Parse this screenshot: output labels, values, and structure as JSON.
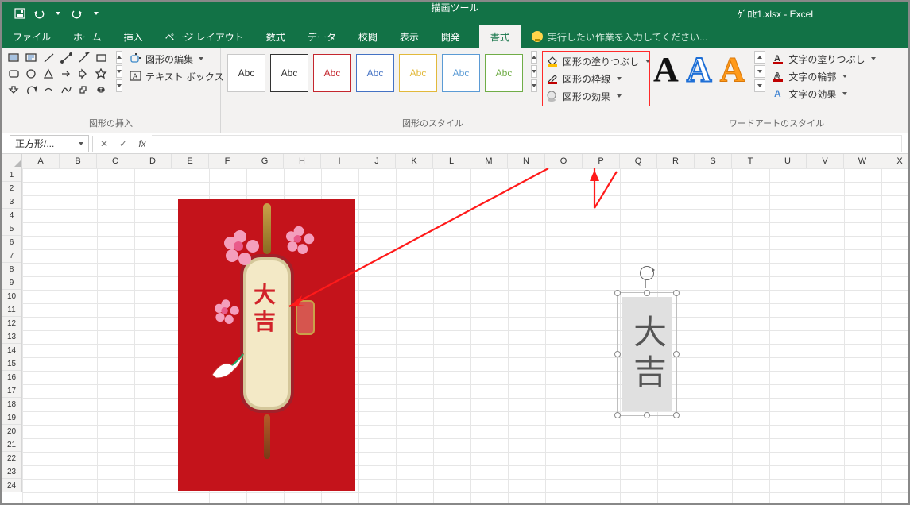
{
  "titlebar": {
    "context_label": "描画ツール",
    "doc_title": "ｹﾞﾛｾ1.xlsx - Excel"
  },
  "tabs": {
    "file": "ファイル",
    "home": "ホーム",
    "insert": "挿入",
    "layout": "ページ レイアウト",
    "formulas": "数式",
    "data": "データ",
    "review": "校閲",
    "view": "表示",
    "developer": "開発",
    "format": "書式",
    "tellme": "実行したい作業を入力してください..."
  },
  "ribbon": {
    "insert_group": "図形の挿入",
    "edit_shape": "図形の編集",
    "text_box": "テキスト ボックス",
    "style_group": "図形のスタイル",
    "style_sample": "Abc",
    "fill": "図形の塗りつぶし",
    "outline": "図形の枠線",
    "effects": "図形の効果",
    "wa_group": "ワードアートのスタイル",
    "wa_sample": "A",
    "txt_fill": "文字の塗りつぶし",
    "txt_outline": "文字の輪郭",
    "txt_effects": "文字の効果"
  },
  "fbar": {
    "name": "正方形/...",
    "expand": "▾"
  },
  "columns": [
    "A",
    "B",
    "C",
    "D",
    "E",
    "F",
    "G",
    "H",
    "I",
    "J",
    "K",
    "L",
    "M",
    "N",
    "O",
    "P",
    "Q",
    "R",
    "S",
    "T",
    "U",
    "V",
    "W",
    "X"
  ],
  "rows": [
    "1",
    "2",
    "3",
    "4",
    "5",
    "6",
    "7",
    "8",
    "9",
    "10",
    "11",
    "12",
    "13",
    "14",
    "15",
    "16",
    "17",
    "18",
    "19",
    "20",
    "21",
    "22",
    "23",
    "24"
  ],
  "artwork": {
    "text": "大吉"
  },
  "shape": {
    "text": "大吉"
  }
}
